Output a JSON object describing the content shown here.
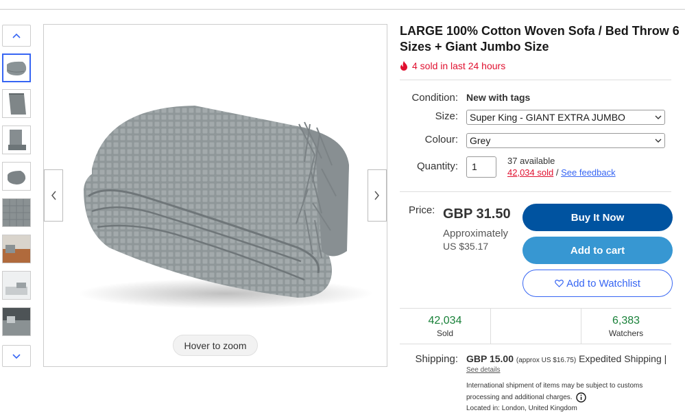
{
  "colors": {
    "accent": "#3665f3",
    "buy": "#0053a0",
    "cart": "#3797d2",
    "hot": "#e0102f",
    "stat": "#188038"
  },
  "gallery": {
    "up_icon": "chevron-up-icon",
    "down_icon": "chevron-down-icon",
    "thumbnails": [
      "blanket-grey-folded",
      "blanket-grey-flat",
      "blanket-grey-sofa",
      "blanket-grey-rolled",
      "blanket-texture",
      "sofa-living-room",
      "bedroom-scene",
      "sofa-scene"
    ],
    "zoom_hint": "Hover to zoom"
  },
  "listing": {
    "title": "LARGE 100% Cotton Woven Sofa / Bed Throw 6 Sizes + Giant Jumbo Size",
    "hot_text": "4 sold in last 24 hours",
    "condition_label": "Condition:",
    "condition_value": "New with tags",
    "size_label": "Size:",
    "size_value": "Super King - GIANT EXTRA JUMBO",
    "colour_label": "Colour:",
    "colour_value": "Grey",
    "quantity_label": "Quantity:",
    "quantity_value": "1",
    "available": "37 available",
    "sold_link": "42,034 sold",
    "sold_sep": "/",
    "feedback_link": "See feedback",
    "price_label": "Price:",
    "price": "GBP 31.50",
    "approx_label": "Approximately",
    "approx_value": "US $35.17",
    "buy_now": "Buy It Now",
    "add_to_cart": "Add to cart",
    "add_to_watchlist": "Add to Watchlist",
    "stats": [
      {
        "value": "42,034",
        "label": "Sold"
      },
      {
        "value": "6,383",
        "label": "Watchers"
      }
    ],
    "shipping_label": "Shipping:",
    "shipping_price": "GBP 15.00",
    "shipping_approx": "(approx US $16.75)",
    "shipping_method": "Expedited Shipping |",
    "see_details": "See details",
    "intl_note": "International shipment of items may be subject to customs processing and additional charges.",
    "location": "Located in: London, United Kingdom"
  }
}
